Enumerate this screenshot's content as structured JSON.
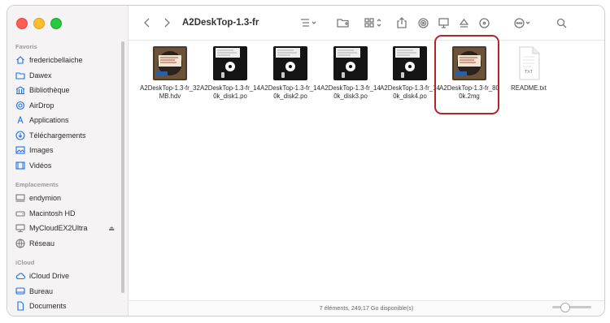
{
  "window": {
    "title": "A2DeskTop-1.3-fr"
  },
  "sidebar": {
    "sections": [
      {
        "label": "Favoris",
        "items": [
          {
            "label": "fredericbellaiche",
            "icon": "home-icon"
          },
          {
            "label": "Dawex",
            "icon": "folder-icon"
          },
          {
            "label": "Bibliothèque",
            "icon": "library-icon"
          },
          {
            "label": "AirDrop",
            "icon": "airdrop-icon"
          },
          {
            "label": "Applications",
            "icon": "applications-icon"
          },
          {
            "label": "Téléchargements",
            "icon": "download-icon"
          },
          {
            "label": "Images",
            "icon": "images-icon"
          },
          {
            "label": "Vidéos",
            "icon": "video-icon"
          }
        ]
      },
      {
        "label": "Emplacements",
        "items": [
          {
            "label": "endymion",
            "icon": "computer-icon"
          },
          {
            "label": "Macintosh HD",
            "icon": "disk-icon"
          },
          {
            "label": "MyCloudEX2Ultra",
            "icon": "network-drive-icon",
            "eject": "⏏"
          },
          {
            "label": "Réseau",
            "icon": "network-icon"
          }
        ]
      },
      {
        "label": "iCloud",
        "items": [
          {
            "label": "iCloud Drive",
            "icon": "cloud-icon"
          },
          {
            "label": "Bureau",
            "icon": "desktop-icon"
          },
          {
            "label": "Documents",
            "icon": "document-icon"
          }
        ]
      }
    ]
  },
  "files": [
    {
      "name": "A2DeskTop-1.3-fr_32MB.hdv",
      "kind": "hdv"
    },
    {
      "name": "A2DeskTop-1.3-fr_140k_disk1.po",
      "kind": "floppy"
    },
    {
      "name": "A2DeskTop-1.3-fr_140k_disk2.po",
      "kind": "floppy"
    },
    {
      "name": "A2DeskTop-1.3-fr_140k_disk3.po",
      "kind": "floppy"
    },
    {
      "name": "A2DeskTop-1.3-fr_140k_disk4.po",
      "kind": "floppy"
    },
    {
      "name": "A2DeskTop-1.3-fr_800k.2mg",
      "kind": "hdv",
      "highlighted": true
    },
    {
      "name": "README.txt",
      "kind": "txt",
      "badge": "TXT"
    }
  ],
  "status": {
    "text": "7 éléments, 249,17 Go disponible(s)"
  },
  "colors": {
    "highlight": "#b3242c",
    "accent": "#1a73e8"
  }
}
